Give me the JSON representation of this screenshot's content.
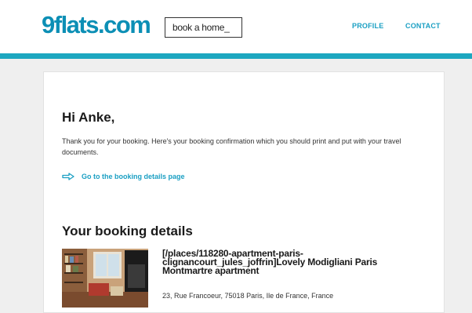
{
  "header": {
    "logo_main": "9flats",
    "logo_suffix": ".com",
    "tagline": "book a home_",
    "nav": {
      "profile": "PROFILE",
      "contact": "CONTACT"
    }
  },
  "email": {
    "greeting": "Hi Anke,",
    "intro": "Thank you for your booking. Here's your booking confirmation which you should print and put with your travel documents.",
    "details_link": "Go to the booking details page",
    "section_title": "Your booking details",
    "listing": {
      "title": "[/places/118280-apartment-paris-clignancourt_jules_joffrin]Lovely Modigliani Paris Montmartre apartment",
      "address": "23, Rue Francoeur, 75018 Paris, Ile de France, France"
    }
  },
  "colors": {
    "brand": "#0c8fb5",
    "link": "#1a9fc3",
    "header_rule": "#1da7c0",
    "page_bg": "#efefef"
  },
  "icons": {
    "details_link_icon": "arrow-right-outline-icon"
  }
}
